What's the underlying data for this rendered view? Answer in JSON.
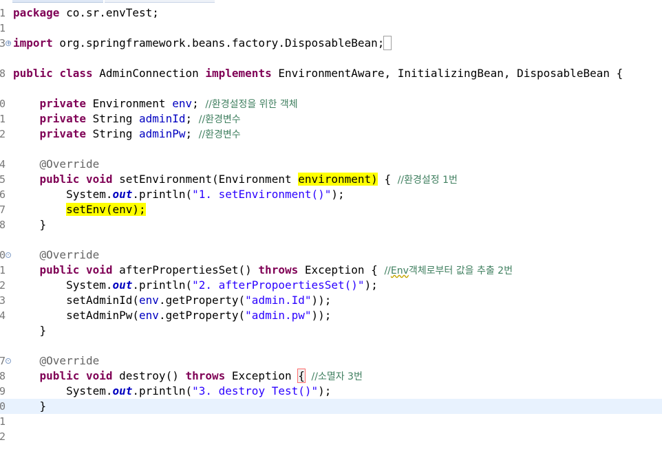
{
  "editor": {
    "lines": [
      {
        "num": "1",
        "tokens": [
          {
            "t": "kw",
            "v": "package"
          },
          {
            "t": "p",
            "v": " co.sr.envTest;"
          }
        ]
      },
      {
        "num": "1",
        "tokens": []
      },
      {
        "num": "3",
        "fold": "+",
        "tokens": [
          {
            "t": "kw",
            "v": "import"
          },
          {
            "t": "p",
            "v": " org.springframework.beans.factory.DisposableBean;"
          },
          {
            "t": "bm",
            "v": " "
          }
        ]
      },
      {
        "num": "",
        "tokens": []
      },
      {
        "num": "8",
        "tokens": [
          {
            "t": "kw",
            "v": "public"
          },
          {
            "t": "p",
            "v": " "
          },
          {
            "t": "kw",
            "v": "class"
          },
          {
            "t": "p",
            "v": " AdminConnection "
          },
          {
            "t": "kw",
            "v": "implements"
          },
          {
            "t": "p",
            "v": " EnvironmentAware, InitializingBean, DisposableBean {"
          }
        ]
      },
      {
        "num": "",
        "tokens": []
      },
      {
        "num": "0",
        "tokens": [
          {
            "t": "p",
            "v": "    "
          },
          {
            "t": "kw",
            "v": "private"
          },
          {
            "t": "p",
            "v": " Environment "
          },
          {
            "t": "fld",
            "v": "env"
          },
          {
            "t": "p",
            "v": "; "
          },
          {
            "t": "cmt",
            "v": "//환경설정을 위한 객체"
          }
        ]
      },
      {
        "num": "1",
        "tokens": [
          {
            "t": "p",
            "v": "    "
          },
          {
            "t": "kw",
            "v": "private"
          },
          {
            "t": "p",
            "v": " String "
          },
          {
            "t": "fld",
            "v": "adminId"
          },
          {
            "t": "p",
            "v": "; "
          },
          {
            "t": "cmt",
            "v": "//환경변수"
          }
        ]
      },
      {
        "num": "2",
        "tokens": [
          {
            "t": "p",
            "v": "    "
          },
          {
            "t": "kw",
            "v": "private"
          },
          {
            "t": "p",
            "v": " String "
          },
          {
            "t": "fld",
            "v": "adminPw"
          },
          {
            "t": "p",
            "v": "; "
          },
          {
            "t": "cmt",
            "v": "//환경변수"
          }
        ]
      },
      {
        "num": "",
        "tokens": []
      },
      {
        "num": "4",
        "tokens": [
          {
            "t": "p",
            "v": "    "
          },
          {
            "t": "ann",
            "v": "@Override"
          }
        ]
      },
      {
        "num": "5",
        "tokens": [
          {
            "t": "p",
            "v": "    "
          },
          {
            "t": "kw",
            "v": "public"
          },
          {
            "t": "p",
            "v": " "
          },
          {
            "t": "kw",
            "v": "void"
          },
          {
            "t": "p",
            "v": " setEnvironment(Environment "
          },
          {
            "t": "hl",
            "v": "environment)"
          },
          {
            "t": "p",
            "v": " { "
          },
          {
            "t": "cmt",
            "v": "//환경설정 1번"
          }
        ]
      },
      {
        "num": "6",
        "tokens": [
          {
            "t": "p",
            "v": "        System."
          },
          {
            "t": "stat",
            "v": "out"
          },
          {
            "t": "p",
            "v": ".println("
          },
          {
            "t": "str",
            "v": "\"1. setEnvironment()\""
          },
          {
            "t": "p",
            "v": ");"
          }
        ]
      },
      {
        "num": "7",
        "tokens": [
          {
            "t": "p",
            "v": "        "
          },
          {
            "t": "hl",
            "v": "setEnv(env);"
          }
        ]
      },
      {
        "num": "8",
        "tokens": [
          {
            "t": "p",
            "v": "    }"
          }
        ]
      },
      {
        "num": "",
        "tokens": []
      },
      {
        "num": "0",
        "fold": "-",
        "tokens": [
          {
            "t": "p",
            "v": "    "
          },
          {
            "t": "ann",
            "v": "@Override"
          }
        ]
      },
      {
        "num": "1",
        "tokens": [
          {
            "t": "p",
            "v": "    "
          },
          {
            "t": "kw",
            "v": "public"
          },
          {
            "t": "p",
            "v": " "
          },
          {
            "t": "kw",
            "v": "void"
          },
          {
            "t": "p",
            "v": " afterPropertiesSet() "
          },
          {
            "t": "kw",
            "v": "throws"
          },
          {
            "t": "p",
            "v": " Exception { "
          },
          {
            "t": "cmt",
            "v": "//"
          },
          {
            "t": "cmtw",
            "v": "Env"
          },
          {
            "t": "cmt",
            "v": "객체로부터 값을 추출 2번"
          }
        ]
      },
      {
        "num": "2",
        "tokens": [
          {
            "t": "p",
            "v": "        System."
          },
          {
            "t": "stat",
            "v": "out"
          },
          {
            "t": "p",
            "v": ".println("
          },
          {
            "t": "str",
            "v": "\"2. afterPropoertiesSet()\""
          },
          {
            "t": "p",
            "v": ");"
          }
        ]
      },
      {
        "num": "3",
        "tokens": [
          {
            "t": "p",
            "v": "        setAdminId("
          },
          {
            "t": "fld",
            "v": "env"
          },
          {
            "t": "p",
            "v": ".getProperty("
          },
          {
            "t": "str",
            "v": "\"admin.Id\""
          },
          {
            "t": "p",
            "v": "));"
          }
        ]
      },
      {
        "num": "4",
        "tokens": [
          {
            "t": "p",
            "v": "        setAdminPw("
          },
          {
            "t": "fld",
            "v": "env"
          },
          {
            "t": "p",
            "v": ".getProperty("
          },
          {
            "t": "str",
            "v": "\"admin.pw\""
          },
          {
            "t": "p",
            "v": "));"
          }
        ]
      },
      {
        "num": "",
        "tokens": [
          {
            "t": "p",
            "v": "    }"
          }
        ]
      },
      {
        "num": "",
        "tokens": []
      },
      {
        "num": "7",
        "fold": "-",
        "tokens": [
          {
            "t": "p",
            "v": "    "
          },
          {
            "t": "ann",
            "v": "@Override"
          }
        ]
      },
      {
        "num": "8",
        "tokens": [
          {
            "t": "p",
            "v": "    "
          },
          {
            "t": "kw",
            "v": "public"
          },
          {
            "t": "p",
            "v": " "
          },
          {
            "t": "kw",
            "v": "void"
          },
          {
            "t": "p",
            "v": " destroy() "
          },
          {
            "t": "kw",
            "v": "throws"
          },
          {
            "t": "p",
            "v": " Exception "
          },
          {
            "t": "brk",
            "v": "{"
          },
          {
            "t": "p",
            "v": " "
          },
          {
            "t": "cmt",
            "v": "//소멸자 3번"
          }
        ]
      },
      {
        "num": "9",
        "tokens": [
          {
            "t": "p",
            "v": "        System."
          },
          {
            "t": "stat",
            "v": "out"
          },
          {
            "t": "p",
            "v": ".println("
          },
          {
            "t": "str",
            "v": "\"3. destroy Test()\""
          },
          {
            "t": "p",
            "v": ");"
          }
        ]
      },
      {
        "num": "0",
        "current": true,
        "tokens": [
          {
            "t": "p",
            "v": "    }"
          }
        ]
      },
      {
        "num": "1",
        "tokens": []
      },
      {
        "num": "2",
        "tokens": []
      }
    ]
  },
  "colors": {
    "keyword": "#7f0055",
    "field": "#0000c0",
    "string": "#2a00ff",
    "comment": "#3f7f5f",
    "annotation": "#646464",
    "highlight": "#ffff00",
    "current_line": "#e8f2fe"
  }
}
